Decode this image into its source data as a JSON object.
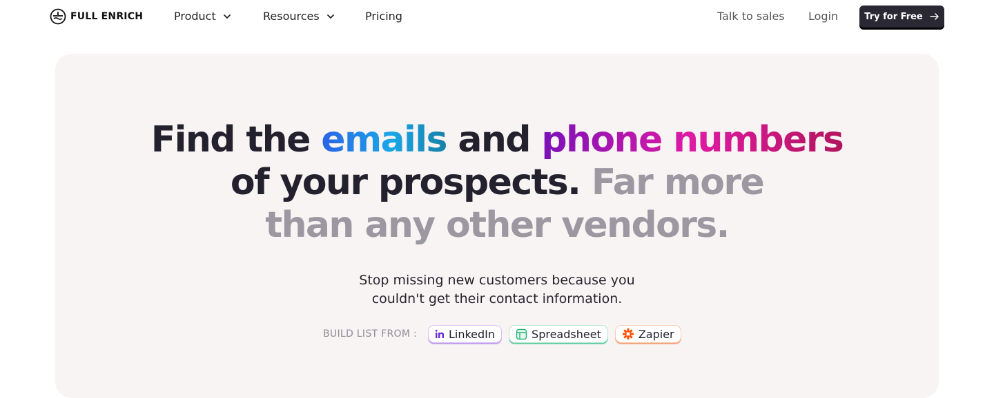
{
  "nav": {
    "brand": "FULL ENRICH",
    "items": [
      {
        "label": "Product"
      },
      {
        "label": "Resources"
      },
      {
        "label": "Pricing"
      }
    ],
    "talk_to_sales": "Talk to sales",
    "login": "Login",
    "cta_label": "Try for Free"
  },
  "hero": {
    "headline": {
      "part1": "Find the ",
      "emails": "emails",
      "part2": " and ",
      "phone_numbers": "phone numbers",
      "line2_dark": "of your prospects. ",
      "line2_muted": "Far more",
      "line3_muted": "than any other vendors."
    },
    "subtitle_line1": "Stop missing new customers because you",
    "subtitle_line2": "couldn't get their contact information.",
    "build_list_label": "BUILD LIST FROM :",
    "sources": [
      {
        "label": "LinkedIn",
        "icon": "linkedin-icon"
      },
      {
        "label": "Spreadsheet",
        "icon": "spreadsheet-icon"
      },
      {
        "label": "Zapier",
        "icon": "zapier-icon"
      }
    ]
  },
  "colors": {
    "cta_bg": "#2a2833",
    "hero_bg": "#f8f4f3",
    "emails_gradient": [
      "#2b63e6",
      "#1aa6e8",
      "#1682a8"
    ],
    "phone_gradient": [
      "#7a12b8",
      "#e01aa5",
      "#b3155e"
    ],
    "muted_text": "#9c98a2"
  }
}
